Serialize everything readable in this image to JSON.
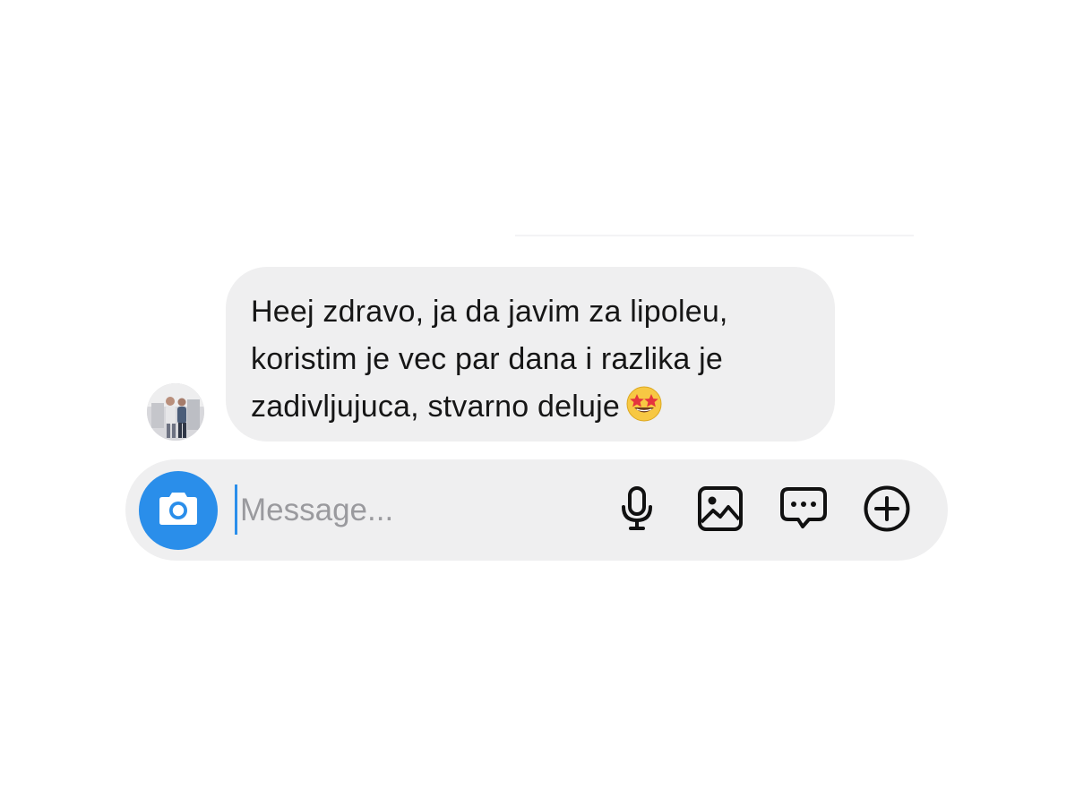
{
  "conversation": {
    "incoming_message": {
      "lines": [
        "Heej zdravo, ja da javim za lipoleu,",
        "koristim je vec par dana i razlika je",
        "zadivljujuca, stvarno deluje"
      ],
      "emoji": "star-struck-emoji"
    }
  },
  "composer": {
    "placeholder": "Message...",
    "value": "",
    "camera_icon": "camera-icon",
    "tools": [
      "microphone-icon",
      "gallery-icon",
      "sticker-chat-icon",
      "plus-icon"
    ]
  },
  "colors": {
    "accent": "#2a8eea",
    "bubble_background": "#efeff0",
    "text": "#161616",
    "placeholder": "#9a9a9e",
    "page_background": "#ffffff"
  }
}
